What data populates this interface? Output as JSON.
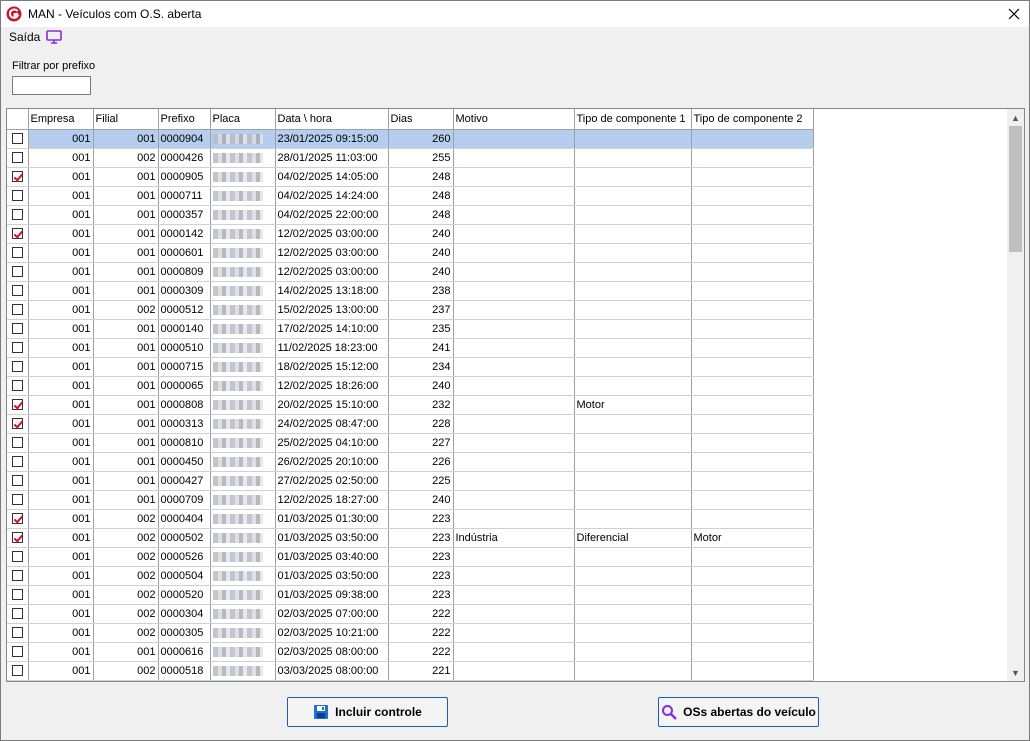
{
  "window": {
    "title": "MAN - Veículos com O.S. aberta"
  },
  "menu": {
    "saida_label": "Saída"
  },
  "filter": {
    "label": "Filtrar por prefixo",
    "value": ""
  },
  "grid": {
    "columns": [
      "Empresa",
      "Filial",
      "Prefixo",
      "Placa",
      "Data \\ hora",
      "Dias",
      "Motivo",
      "Tipo de componente 1",
      "Tipo de componente 2"
    ],
    "rows": [
      {
        "checked": false,
        "empresa": "001",
        "filial": "001",
        "prefixo": "0000904",
        "data_hora": "23/01/2025 09:15:00",
        "dias": "260",
        "motivo": "",
        "tipo1": "",
        "tipo2": "",
        "selected": true
      },
      {
        "checked": false,
        "empresa": "001",
        "filial": "002",
        "prefixo": "0000426",
        "data_hora": "28/01/2025 11:03:00",
        "dias": "255",
        "motivo": "",
        "tipo1": "",
        "tipo2": ""
      },
      {
        "checked": true,
        "empresa": "001",
        "filial": "001",
        "prefixo": "0000905",
        "data_hora": "04/02/2025 14:05:00",
        "dias": "248",
        "motivo": "",
        "tipo1": "",
        "tipo2": ""
      },
      {
        "checked": false,
        "empresa": "001",
        "filial": "001",
        "prefixo": "0000711",
        "data_hora": "04/02/2025 14:24:00",
        "dias": "248",
        "motivo": "",
        "tipo1": "",
        "tipo2": ""
      },
      {
        "checked": false,
        "empresa": "001",
        "filial": "001",
        "prefixo": "0000357",
        "data_hora": "04/02/2025 22:00:00",
        "dias": "248",
        "motivo": "",
        "tipo1": "",
        "tipo2": ""
      },
      {
        "checked": true,
        "empresa": "001",
        "filial": "001",
        "prefixo": "0000142",
        "data_hora": "12/02/2025 03:00:00",
        "dias": "240",
        "motivo": "",
        "tipo1": "",
        "tipo2": ""
      },
      {
        "checked": false,
        "empresa": "001",
        "filial": "001",
        "prefixo": "0000601",
        "data_hora": "12/02/2025 03:00:00",
        "dias": "240",
        "motivo": "",
        "tipo1": "",
        "tipo2": ""
      },
      {
        "checked": false,
        "empresa": "001",
        "filial": "001",
        "prefixo": "0000809",
        "data_hora": "12/02/2025 03:00:00",
        "dias": "240",
        "motivo": "",
        "tipo1": "",
        "tipo2": ""
      },
      {
        "checked": false,
        "empresa": "001",
        "filial": "001",
        "prefixo": "0000309",
        "data_hora": "14/02/2025 13:18:00",
        "dias": "238",
        "motivo": "",
        "tipo1": "",
        "tipo2": ""
      },
      {
        "checked": false,
        "empresa": "001",
        "filial": "002",
        "prefixo": "0000512",
        "data_hora": "15/02/2025 13:00:00",
        "dias": "237",
        "motivo": "",
        "tipo1": "",
        "tipo2": ""
      },
      {
        "checked": false,
        "empresa": "001",
        "filial": "001",
        "prefixo": "0000140",
        "data_hora": "17/02/2025 14:10:00",
        "dias": "235",
        "motivo": "",
        "tipo1": "",
        "tipo2": ""
      },
      {
        "checked": false,
        "empresa": "001",
        "filial": "001",
        "prefixo": "0000510",
        "data_hora": "11/02/2025 18:23:00",
        "dias": "241",
        "motivo": "",
        "tipo1": "",
        "tipo2": ""
      },
      {
        "checked": false,
        "empresa": "001",
        "filial": "001",
        "prefixo": "0000715",
        "data_hora": "18/02/2025 15:12:00",
        "dias": "234",
        "motivo": "",
        "tipo1": "",
        "tipo2": ""
      },
      {
        "checked": false,
        "empresa": "001",
        "filial": "001",
        "prefixo": "0000065",
        "data_hora": "12/02/2025 18:26:00",
        "dias": "240",
        "motivo": "",
        "tipo1": "",
        "tipo2": ""
      },
      {
        "checked": true,
        "empresa": "001",
        "filial": "001",
        "prefixo": "0000808",
        "data_hora": "20/02/2025 15:10:00",
        "dias": "232",
        "motivo": "",
        "tipo1": "Motor",
        "tipo2": ""
      },
      {
        "checked": true,
        "empresa": "001",
        "filial": "001",
        "prefixo": "0000313",
        "data_hora": "24/02/2025 08:47:00",
        "dias": "228",
        "motivo": "",
        "tipo1": "",
        "tipo2": ""
      },
      {
        "checked": false,
        "empresa": "001",
        "filial": "001",
        "prefixo": "0000810",
        "data_hora": "25/02/2025 04:10:00",
        "dias": "227",
        "motivo": "",
        "tipo1": "",
        "tipo2": ""
      },
      {
        "checked": false,
        "empresa": "001",
        "filial": "001",
        "prefixo": "0000450",
        "data_hora": "26/02/2025 20:10:00",
        "dias": "226",
        "motivo": "",
        "tipo1": "",
        "tipo2": ""
      },
      {
        "checked": false,
        "empresa": "001",
        "filial": "001",
        "prefixo": "0000427",
        "data_hora": "27/02/2025 02:50:00",
        "dias": "225",
        "motivo": "",
        "tipo1": "",
        "tipo2": ""
      },
      {
        "checked": false,
        "empresa": "001",
        "filial": "001",
        "prefixo": "0000709",
        "data_hora": "12/02/2025 18:27:00",
        "dias": "240",
        "motivo": "",
        "tipo1": "",
        "tipo2": ""
      },
      {
        "checked": true,
        "empresa": "001",
        "filial": "002",
        "prefixo": "0000404",
        "data_hora": "01/03/2025 01:30:00",
        "dias": "223",
        "motivo": "",
        "tipo1": "",
        "tipo2": ""
      },
      {
        "checked": true,
        "empresa": "001",
        "filial": "002",
        "prefixo": "0000502",
        "data_hora": "01/03/2025 03:50:00",
        "dias": "223",
        "motivo": "Indústria",
        "tipo1": "Diferencial",
        "tipo2": "Motor"
      },
      {
        "checked": false,
        "empresa": "001",
        "filial": "002",
        "prefixo": "0000526",
        "data_hora": "01/03/2025 03:40:00",
        "dias": "223",
        "motivo": "",
        "tipo1": "",
        "tipo2": ""
      },
      {
        "checked": false,
        "empresa": "001",
        "filial": "002",
        "prefixo": "0000504",
        "data_hora": "01/03/2025 03:50:00",
        "dias": "223",
        "motivo": "",
        "tipo1": "",
        "tipo2": ""
      },
      {
        "checked": false,
        "empresa": "001",
        "filial": "002",
        "prefixo": "0000520",
        "data_hora": "01/03/2025 09:38:00",
        "dias": "223",
        "motivo": "",
        "tipo1": "",
        "tipo2": ""
      },
      {
        "checked": false,
        "empresa": "001",
        "filial": "002",
        "prefixo": "0000304",
        "data_hora": "02/03/2025 07:00:00",
        "dias": "222",
        "motivo": "",
        "tipo1": "",
        "tipo2": ""
      },
      {
        "checked": false,
        "empresa": "001",
        "filial": "002",
        "prefixo": "0000305",
        "data_hora": "02/03/2025 10:21:00",
        "dias": "222",
        "motivo": "",
        "tipo1": "",
        "tipo2": ""
      },
      {
        "checked": false,
        "empresa": "001",
        "filial": "001",
        "prefixo": "0000616",
        "data_hora": "02/03/2025 08:00:00",
        "dias": "222",
        "motivo": "",
        "tipo1": "",
        "tipo2": ""
      },
      {
        "checked": false,
        "empresa": "001",
        "filial": "002",
        "prefixo": "0000518",
        "data_hora": "03/03/2025 08:00:00",
        "dias": "221",
        "motivo": "",
        "tipo1": "",
        "tipo2": ""
      }
    ]
  },
  "buttons": {
    "incluir": "Incluir controle",
    "oss_abertas": "OSs abertas do veículo"
  },
  "colors": {
    "accent": "#d0102a",
    "selection": "#b5cdef",
    "button_border": "#1a5fb4",
    "icon_purple": "#8a2be2"
  },
  "icons": {
    "app": "app-logo-icon",
    "close": "close-icon",
    "monitor": "monitor-icon",
    "save": "save-icon",
    "search": "search-icon"
  }
}
